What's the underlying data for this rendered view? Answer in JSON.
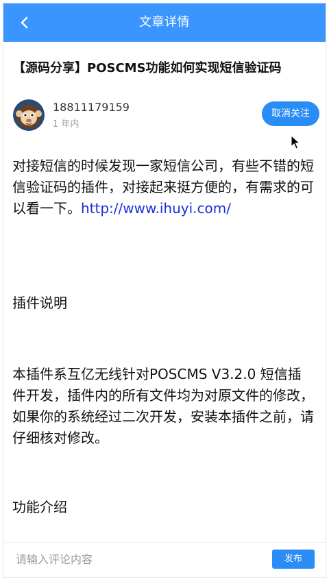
{
  "header": {
    "title": "文章详情",
    "back_icon": "chevron-left-icon"
  },
  "article": {
    "title": "【源码分享】POSCMS功能如何实现短信验证码",
    "author": {
      "name": "18811179159",
      "time": "1 年内",
      "avatar_icon": "monkey-avatar"
    },
    "follow_label": "取消关注",
    "paragraphs": {
      "p1_text": "对接短信的时候发现一家短信公司，有些不错的短信验证码的插件，对接起来挺方便的，有需求的可以看一下。",
      "p1_link": "http://www.ihuyi.com/",
      "p2": "插件说明",
      "p3": "本插件系互亿无线针对POSCMS V3.2.0 短信插件开发，插件内的所有文件均为对原文件的修改，如果你的系统经过二次开发，安装本插件之前，请仔细核对修改。",
      "p4": "功能介绍"
    }
  },
  "comment": {
    "placeholder": "请输入评论内容",
    "publish_label": "发布"
  },
  "colors": {
    "header_bg": "#3b95ff",
    "button_bg": "#2a8cf5",
    "link": "#1a2fd6"
  }
}
